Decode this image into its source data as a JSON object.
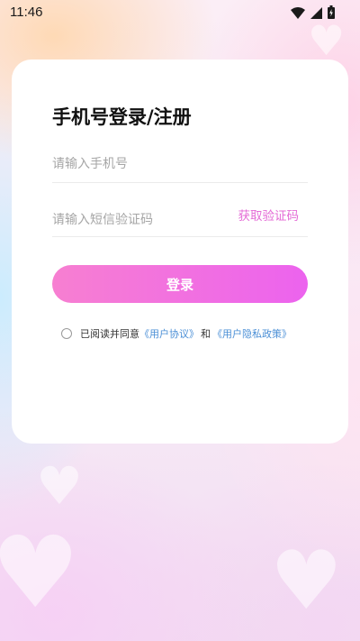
{
  "status_bar": {
    "time": "11:46"
  },
  "login": {
    "title": "手机号登录/注册",
    "phone_placeholder": "请输入手机号",
    "code_placeholder": "请输入短信验证码",
    "get_code_label": "获取验证码",
    "submit_label": "登录",
    "agree_text": "已阅读并同意",
    "user_agreement": "《用户协议》",
    "and_text": "和",
    "privacy_policy": "《用户隐私政策》"
  },
  "colors": {
    "accent_gradient_start": "#f77fd1",
    "accent_gradient_end": "#ec63ee",
    "get_code_color": "#e46bd6",
    "link_color": "#4b8fd6"
  },
  "icons": [
    "wifi-icon",
    "signal-icon",
    "battery-icon"
  ]
}
